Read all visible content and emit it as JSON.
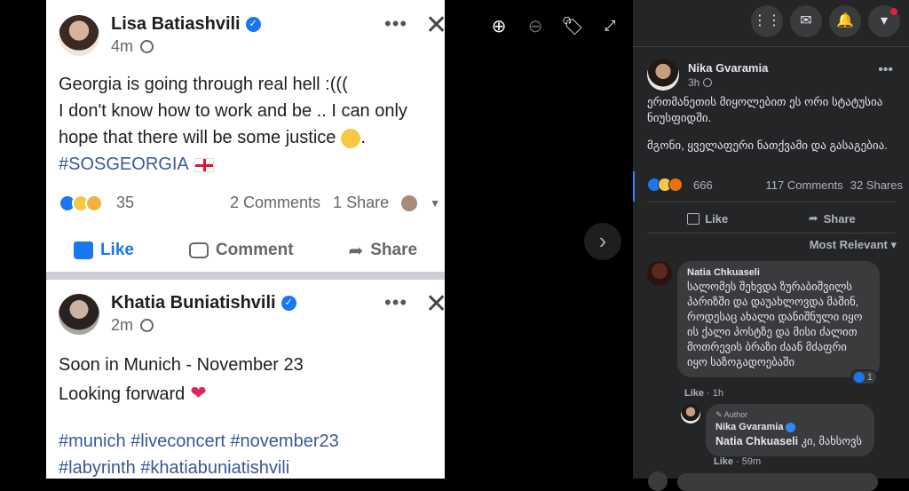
{
  "photo": {
    "post1": {
      "name": "Lisa Batiashvili",
      "time": "4m",
      "lines": [
        "Georgia is going through real hell :(((",
        "I don't know how to work and be .. I  can only",
        "hope that there will be some justice"
      ],
      "hashtag": "#SOSGEORGIA",
      "reaction_count": "35",
      "comments": "2 Comments",
      "shares": "1 Share",
      "like": "Like",
      "comment": "Comment",
      "share": "Share"
    },
    "post2": {
      "name": "Khatia Buniatishvili",
      "time": "2m",
      "line1": "Soon in Munich - November 23",
      "line2": "Looking forward",
      "tags1": "#munich #liveconcert #november23",
      "tags2": "#labyrinth #khatiabuniatishvili"
    }
  },
  "side": {
    "author": "Nika Gvaramia",
    "time": "3h",
    "text1": "ერთმანეთის მიყოლებით ეს ორი სტატუსია ნიუსფიდში.",
    "text2": "მგონი, ყველაფერი ნათქვამი და გასაგებია.",
    "reactions": "666",
    "comments": "117 Comments",
    "shares": "32 Shares",
    "like": "Like",
    "share": "Share",
    "sort": "Most Relevant",
    "comment1": {
      "name": "Natia Chkuaseli",
      "text": "სალომეს შეხვდა ზურაბიშვილს პარიზში და დაუახლოვდა მაშინ, როდესაც ახალი დანიშნული იყო ის ქალი პოსტზე და მისი ძალით მოთრევის ბრაზი ძაან მძაფრი იყო საზოგადოებაში",
      "reaction_count": "1",
      "like": "Like",
      "time": "1h"
    },
    "reply1": {
      "badge": "Author",
      "name": "Nika Gvaramia",
      "mention": "Natia Chkuaseli",
      "text": " კი, მახსოვს",
      "like": "Like",
      "time": "59m"
    }
  }
}
